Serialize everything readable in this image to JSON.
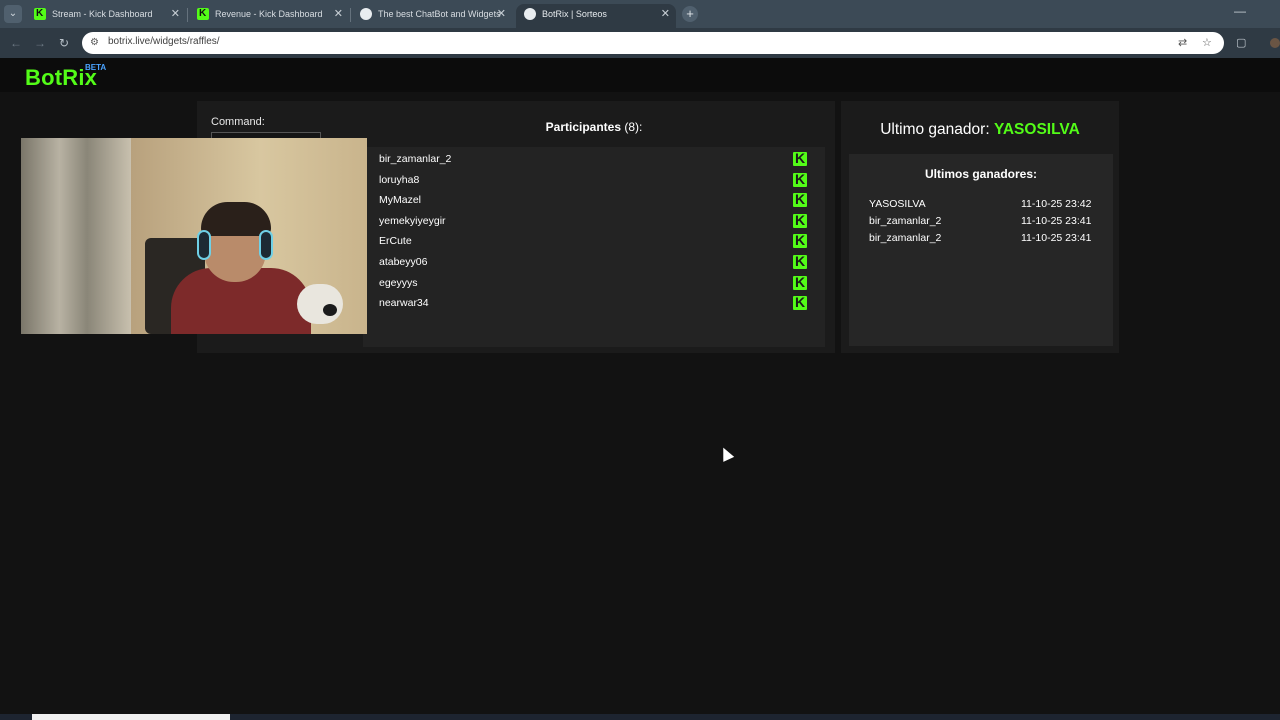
{
  "browser": {
    "tabs": [
      {
        "title": "Stream - Kick Dashboard",
        "favicon": "kick-icon"
      },
      {
        "title": "Revenue - Kick Dashboard",
        "favicon": "kick-icon"
      },
      {
        "title": "The best ChatBot and Widgets",
        "favicon": "globe-icon"
      },
      {
        "title": "BotRix | Sorteos",
        "favicon": "globe-icon"
      }
    ],
    "url": "botrix.live/widgets/raffles/"
  },
  "site": {
    "logo": "BotRix",
    "badge": "BETA"
  },
  "raffle": {
    "command_label": "Command:",
    "participants_label": "Participantes",
    "participants_count": "(8):",
    "participants": [
      "bir_zamanlar_2",
      "loruyha8",
      "MyMazel",
      "yemekyiyeygir",
      "ErCute",
      "atabeyy06",
      "egeyyys",
      "nearwar34"
    ]
  },
  "winners": {
    "last_winner_label": "Ultimo ganador:",
    "last_winner_name": "YASOSILVA",
    "list_title": "Ultimos ganadores:",
    "list": [
      {
        "name": "YASOSILVA",
        "time": "11-10-25 23:42"
      },
      {
        "name": "bir_zamanlar_2",
        "time": "11-10-25 23:41"
      },
      {
        "name": "bir_zamanlar_2",
        "time": "11-10-25 23:41"
      }
    ]
  },
  "colors": {
    "accent": "#53fc18",
    "background": "#121212",
    "panel": "#1b1b1b"
  }
}
